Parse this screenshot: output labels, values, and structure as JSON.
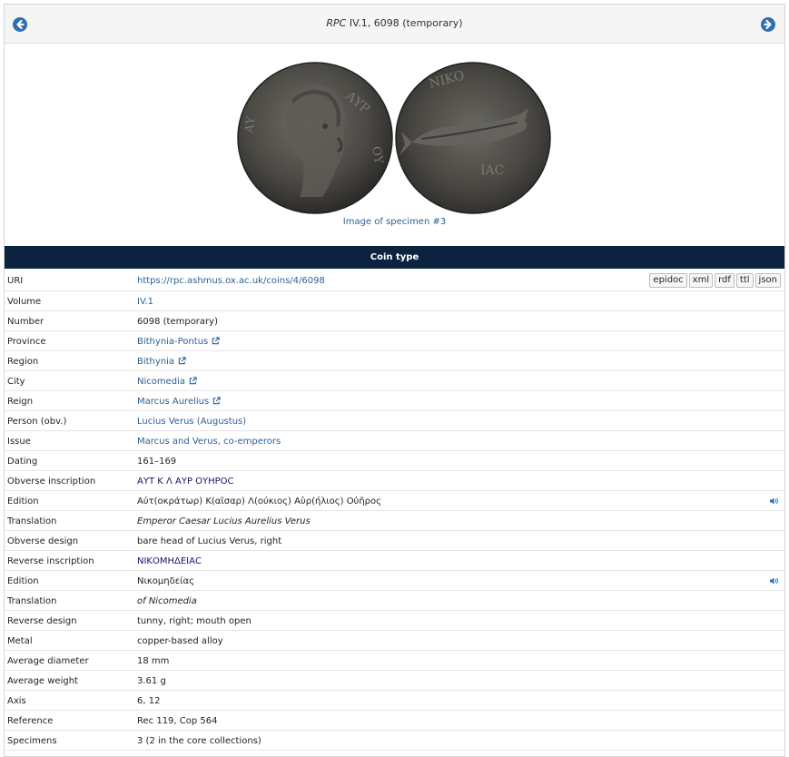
{
  "header": {
    "title_italic": "RPC",
    "title_rest": " IV.1, 6098 (temporary)"
  },
  "image": {
    "caption": "Image of specimen #3"
  },
  "section_title": "Coin type",
  "formats": [
    "epidoc",
    "xml",
    "rdf",
    "ttl",
    "json"
  ],
  "rows": [
    {
      "label": "URI",
      "value": "https://rpc.ashmus.ox.ac.uk/coins/4/6098",
      "style": "link"
    },
    {
      "label": "Volume",
      "value": "IV.1",
      "style": "link"
    },
    {
      "label": "Number",
      "value": "6098 (temporary)",
      "style": "plain"
    },
    {
      "label": "Province",
      "value": "Bithynia-Pontus",
      "style": "link",
      "external": true
    },
    {
      "label": "Region",
      "value": "Bithynia",
      "style": "link",
      "external": true
    },
    {
      "label": "City",
      "value": "Nicomedia",
      "style": "link",
      "external": true
    },
    {
      "label": "Reign",
      "value": "Marcus Aurelius",
      "style": "link",
      "external": true
    },
    {
      "label": "Person (obv.)",
      "value": "Lucius Verus (Augustus)",
      "style": "link"
    },
    {
      "label": "Issue",
      "value": "Marcus and Verus, co-emperors",
      "style": "link"
    },
    {
      "label": "Dating",
      "value": "161–169",
      "style": "plain"
    },
    {
      "label": "Obverse inscription",
      "value": "ΑΥΤ Κ Λ ΑΥΡ ΟΥΗΡΟϹ",
      "style": "greek"
    },
    {
      "label": "Edition",
      "value": "Αὐτ(οκράτωρ) Κ(αῖσαρ) Λ(ούκιος) Αὐρ(ήλιος) Οὐῆρος",
      "style": "plain",
      "audio": true
    },
    {
      "label": "Translation",
      "value": "Emperor Caesar Lucius Aurelius Verus",
      "style": "italic"
    },
    {
      "label": "Obverse design",
      "value": "bare head of Lucius Verus, right",
      "style": "plain"
    },
    {
      "label": "Reverse inscription",
      "value": "ΝΙΚΟΜΗΔΕΙΑϹ",
      "style": "greek"
    },
    {
      "label": "Edition",
      "value": "Νικομηδείας",
      "style": "plain",
      "audio": true
    },
    {
      "label": "Translation",
      "value": "of Nicomedia",
      "style": "italic"
    },
    {
      "label": "Reverse design",
      "value": "tunny, right; mouth open",
      "style": "plain"
    },
    {
      "label": "Metal",
      "value": "copper-based alloy",
      "style": "plain"
    },
    {
      "label": "Average diameter",
      "value": "18 mm",
      "style": "plain"
    },
    {
      "label": "Average weight",
      "value": "3.61 g",
      "style": "plain"
    },
    {
      "label": "Axis",
      "value": "6, 12",
      "style": "plain"
    },
    {
      "label": "Reference",
      "value": "Rec 119, Cop 564",
      "style": "plain"
    },
    {
      "label": "Specimens",
      "value": "3 (2 in the core collections)",
      "style": "plain"
    }
  ],
  "colors": {
    "link": "#2d5f93",
    "greek": "#13136e",
    "bar": "#0c2340",
    "nav": "#2f6fb1"
  },
  "icons": {
    "prev": "arrow-left-circle-icon",
    "next": "arrow-right-circle-icon",
    "external": "external-link-icon",
    "audio": "speaker-icon"
  }
}
